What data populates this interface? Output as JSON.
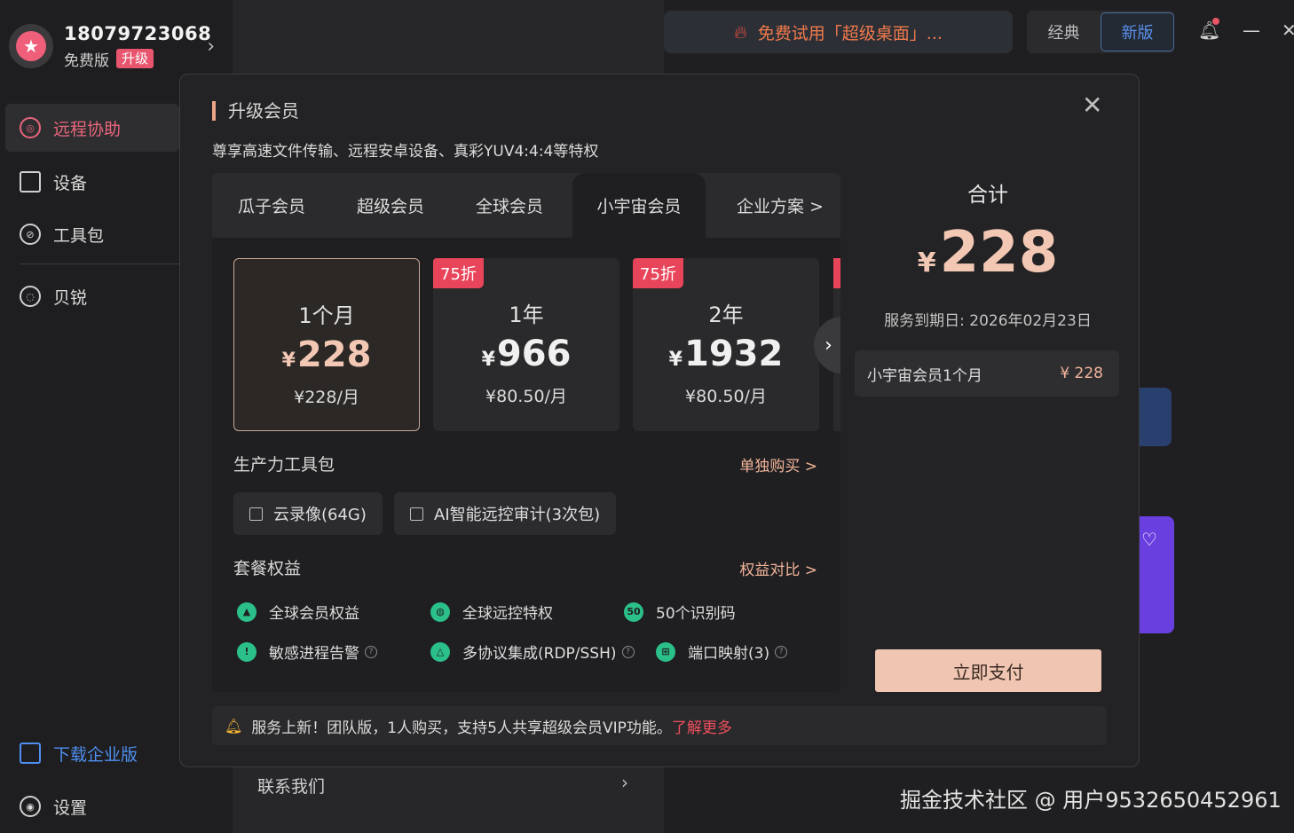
{
  "user": {
    "phone": "18079723068",
    "plan": "免费版",
    "upgrade": "升级"
  },
  "sidebar": {
    "items": [
      {
        "label": "远程协助"
      },
      {
        "label": "设备"
      },
      {
        "label": "工具包"
      },
      {
        "label": "贝锐"
      }
    ],
    "download": "下载企业版",
    "settings": "设置"
  },
  "middle": {
    "contact": "联系我们"
  },
  "topbar": {
    "promo": "免费试用「超级桌面」...",
    "mode_classic": "经典",
    "mode_new": "新版"
  },
  "watermark": "掘金技术社区 @ 用户9532650452961",
  "modal": {
    "title": "升级会员",
    "subtitle": "尊享高速文件传输、远程安卓设备、真彩YUV4:4:4等特权",
    "tabs": [
      "瓜子会员",
      "超级会员",
      "全球会员",
      "小宇宙会员",
      "企业方案 >"
    ],
    "plans": [
      {
        "duration": "1个月",
        "yen": "¥",
        "price": "228",
        "monthly": "¥228/月",
        "badge": ""
      },
      {
        "duration": "1年",
        "yen": "¥",
        "price": "966",
        "monthly": "¥80.50/月",
        "badge": "75折"
      },
      {
        "duration": "2年",
        "yen": "¥",
        "price": "1932",
        "monthly": "¥80.50/月",
        "badge": "75折"
      }
    ],
    "toolkit_title": "生产力工具包",
    "toolkit_link": "单独购买 >",
    "addons": [
      "云录像(64G)",
      "AI智能远控审计(3次包)"
    ],
    "benefits_title": "套餐权益",
    "benefits_link": "权益对比 >",
    "benefits": [
      "全球会员权益",
      "全球远控特权",
      "50个识别码",
      "敏感进程告警",
      "多协议集成(RDP/SSH)",
      "端口映射(3)"
    ],
    "summary": {
      "title": "合计",
      "yen": "¥",
      "price": "228",
      "expiry": "服务到期日: 2026年02月23日",
      "item_name": "小宇宙会员1个月",
      "item_amount": "¥ 228",
      "pay": "立即支付"
    },
    "notice": {
      "text": "服务上新！团队版，1人购买，支持5人共享超级会员VIP功能。",
      "more": "了解更多"
    }
  }
}
